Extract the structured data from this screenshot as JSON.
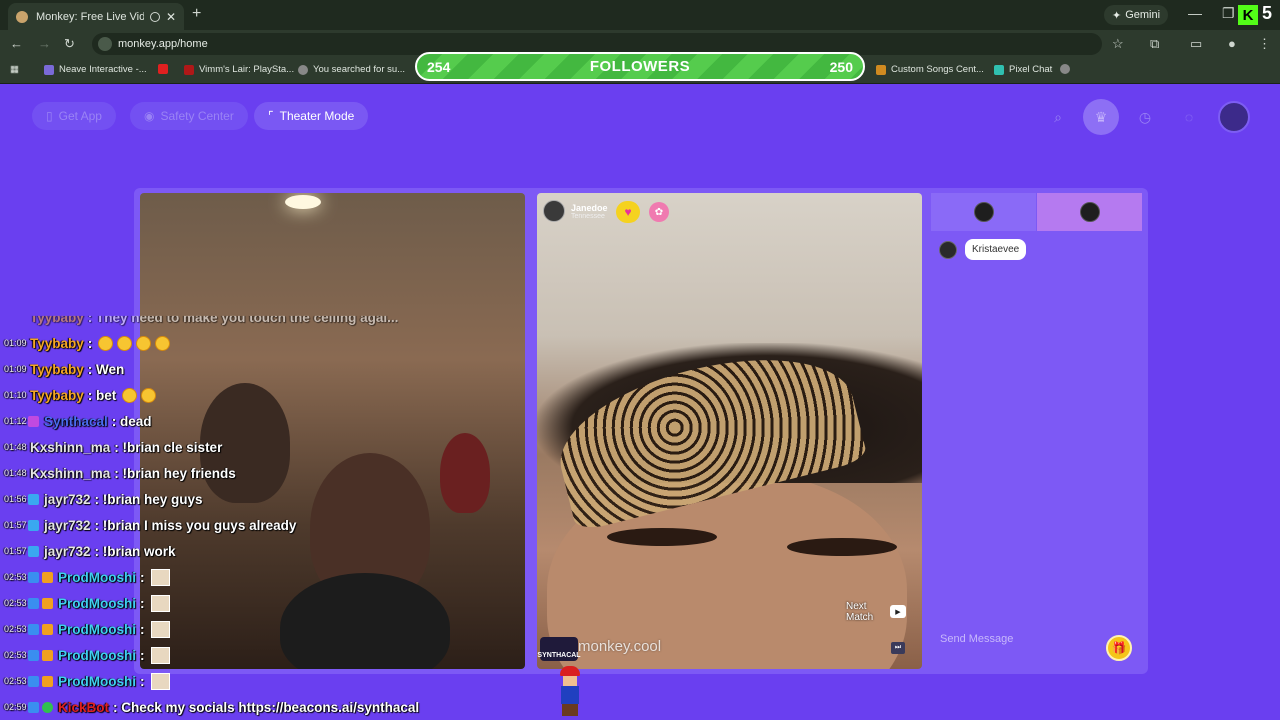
{
  "browser": {
    "tab_title": "Monkey: Free Live Video Ch",
    "new_tab": "+",
    "gemini_label": "Gemini",
    "url": "monkey.app/home",
    "bookmarks": [
      "Neave Interactive -...",
      "Vimm's Lair: PlaySta...",
      "You searched for su...",
      "Custom Songs Cent...",
      "Pixel Chat"
    ],
    "k_badge": "5"
  },
  "followers_overlay": {
    "left_count": "254",
    "label": "FOLLOWERS",
    "right_count": "250"
  },
  "header": {
    "get_app": "Get App",
    "safety_center": "Safety Center",
    "theater_mode": "Theater Mode"
  },
  "match": {
    "username": "Janedoe",
    "location": "Tennessee",
    "next_match_line1": "Next",
    "next_match_line2": "Match",
    "watermark": "monkey.cool",
    "logo_text": "SYNTHACAL"
  },
  "side_chat": {
    "entry_name": "Kristaevee",
    "send_placeholder": "Send Message"
  },
  "stream_chat": [
    {
      "time": "",
      "user": "Tyybaby",
      "color": "#f5a623",
      "msg": ": They need to make you touch the ceiling agai...",
      "badge": ""
    },
    {
      "time": "01:09",
      "user": "Tyybaby",
      "color": "#f5a623",
      "msg": ":",
      "emotes": 4,
      "badge": ""
    },
    {
      "time": "01:09",
      "user": "Tyybaby",
      "color": "#f5a623",
      "msg": ": Wen",
      "badge": ""
    },
    {
      "time": "01:10",
      "user": "Tyybaby",
      "color": "#f5a623",
      "msg": ": bet",
      "emotes": 2,
      "badge": ""
    },
    {
      "time": "01:12",
      "user": "Synthacal",
      "color": "#4a6cf0",
      "msg": ": dead",
      "badge": "#c04ae0"
    },
    {
      "time": "01:48",
      "user": "Kxshinn_ma",
      "color": "#e6e6e6",
      "msg": ": !brian cle sister",
      "badge": ""
    },
    {
      "time": "01:48",
      "user": "Kxshinn_ma",
      "color": "#e6e6e6",
      "msg": ": !brian hey friends",
      "badge": ""
    },
    {
      "time": "01:56",
      "user": "jayr732",
      "color": "#e6e6e6",
      "msg": ": !brian hey guys",
      "badge": "#3aa8f0"
    },
    {
      "time": "01:57",
      "user": "jayr732",
      "color": "#e6e6e6",
      "msg": ": !brian I miss you guys already",
      "badge": "#3aa8f0"
    },
    {
      "time": "01:57",
      "user": "jayr732",
      "color": "#e6e6e6",
      "msg": ": !brian work",
      "badge": "#3aa8f0"
    },
    {
      "time": "02:53",
      "user": "ProdMooshi",
      "color": "#3fd0f0",
      "msg": ":",
      "square": true,
      "badge": "#3a8ef0"
    },
    {
      "time": "02:53",
      "user": "ProdMooshi",
      "color": "#3fd0f0",
      "msg": ":",
      "square": true,
      "badge": "#3a8ef0"
    },
    {
      "time": "02:53",
      "user": "ProdMooshi",
      "color": "#3fd0f0",
      "msg": ":",
      "square": true,
      "badge": "#3a8ef0"
    },
    {
      "time": "02:53",
      "user": "ProdMooshi",
      "color": "#3fd0f0",
      "msg": ":",
      "square": true,
      "badge": "#3a8ef0"
    },
    {
      "time": "02:53",
      "user": "ProdMooshi",
      "color": "#3fd0f0",
      "msg": ":",
      "square": true,
      "badge": "#3a8ef0"
    },
    {
      "time": "02:59",
      "user": "KickBot",
      "color": "#e02020",
      "msg": ": Check my socials https://beacons.ai/synthacal",
      "badge": "#3a8ef0"
    }
  ],
  "colors": {
    "app_bg": "#6a3ff0",
    "panel": "#7d59f5",
    "followers_green": "#43b840"
  }
}
